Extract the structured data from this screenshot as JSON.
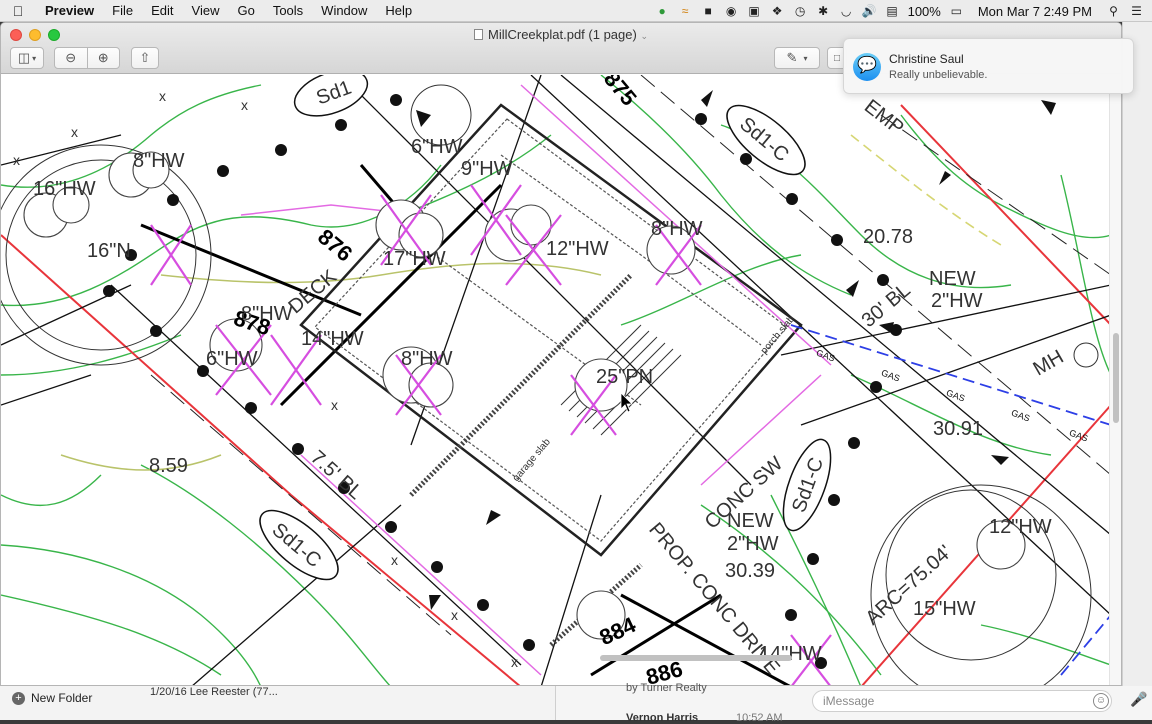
{
  "menubar": {
    "app_name": "Preview",
    "menus": [
      "File",
      "Edit",
      "View",
      "Go",
      "Tools",
      "Window",
      "Help"
    ],
    "battery": "100%",
    "datetime": "Mon Mar 7  2:49 PM"
  },
  "window": {
    "title": "MillCreekplat.pdf (1 page)"
  },
  "notification": {
    "sender": "Christine Saul",
    "message": "Really unbelievable."
  },
  "background": {
    "finder_new_folder": "New Folder",
    "finder_row": "1/20/16  Lee Reester (77...",
    "messages_subtitle": "by Turner Realty",
    "messages_sender": "Vernon Harris",
    "messages_time": "10:52 AM",
    "imessage_placeholder": "iMessage"
  },
  "plat": {
    "labels": {
      "sd1_top": "Sd1",
      "sd1c_right": "Sd1-C",
      "sd1c_left": "Sd1-C",
      "sd1c_mid": "Sd1-C",
      "c876": "876",
      "c878": "878",
      "c875": "875",
      "c884": "884",
      "c886": "886",
      "hw16": "16\"HW",
      "hw8a": "8\"HW",
      "hw6": "6\"HW",
      "hw9": "9\"HW",
      "hw8b": "8\"HW",
      "hw8c": "8\"HW",
      "hw14": "14\"HW",
      "hw8d": "8\"HW",
      "n16": "16\"N",
      "hw6b": "6\"HW",
      "hw17": "17\"HW",
      "hw12": "12\"HW",
      "pn25": "25\"PN",
      "deck": "DECK",
      "porch_slab": "porch slab",
      "garage_slab": "garage slab",
      "v2078": "20.78",
      "bl30": "30' BL",
      "new2hw": "NEW\n2\"HW",
      "mh": "MH",
      "v3091": "30.91",
      "v859": "8.59",
      "bl75": "7.5' BL",
      "conc_sw": "CONC SW",
      "new2hw_b": "NEW\n2\"HW",
      "v3039": "30.39",
      "prop_conc": "PROP. CONC DRIVE",
      "hw14b": "14\"HW",
      "hw12b": "12\"HW",
      "hw15": "15\"HW",
      "arc": "ARC=75.04'",
      "emp": "EMP",
      "gas": "GAS"
    }
  }
}
